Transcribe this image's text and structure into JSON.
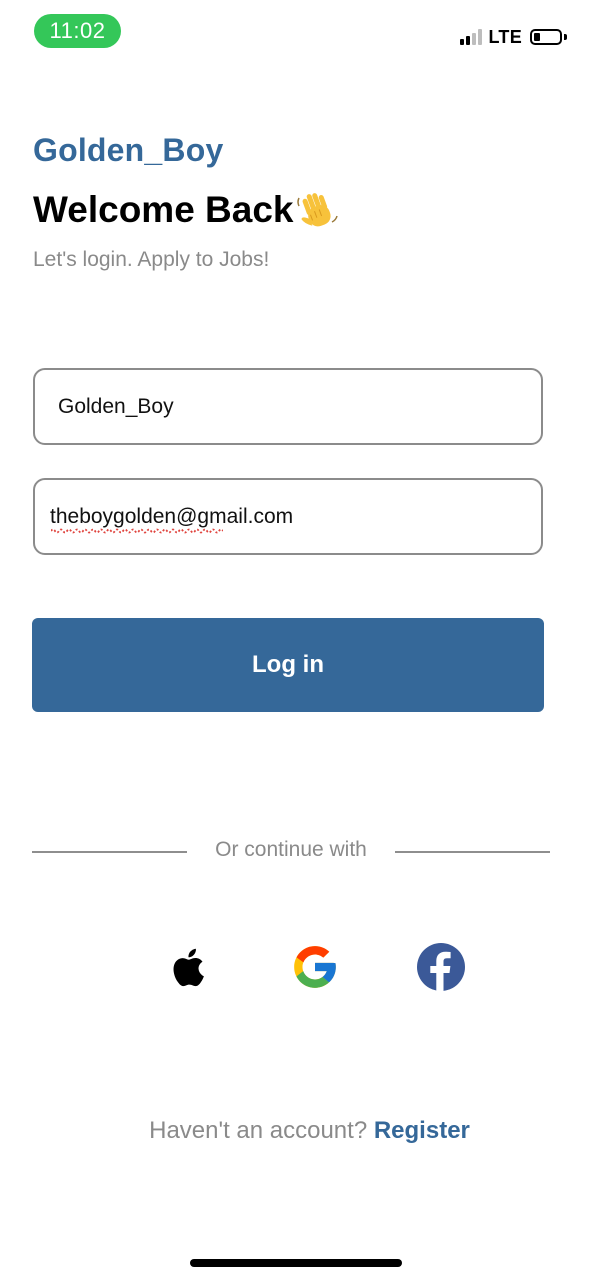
{
  "status_bar": {
    "time": "11:02",
    "network": "LTE",
    "time_pill_color": "#34c759",
    "signal_bars": 4,
    "signal_bars_active": 2,
    "battery_level": 0.2
  },
  "header": {
    "brand": "Golden_Boy",
    "title": "Welcome Back",
    "subtitle": "Let's login. Apply to Jobs!"
  },
  "form": {
    "username_value": "Golden_Boy",
    "email_value": "theboygolden@gmail.com",
    "login_label": "Log in"
  },
  "divider": {
    "label": "Or continue with"
  },
  "social": [
    {
      "name": "apple-icon"
    },
    {
      "name": "google-icon"
    },
    {
      "name": "facebook-icon"
    }
  ],
  "footer": {
    "prompt": "Haven't an account?",
    "register_label": "Register"
  },
  "colors": {
    "primary": "#356899",
    "muted_text": "#8a8a8a",
    "border": "#8b8b8b"
  }
}
